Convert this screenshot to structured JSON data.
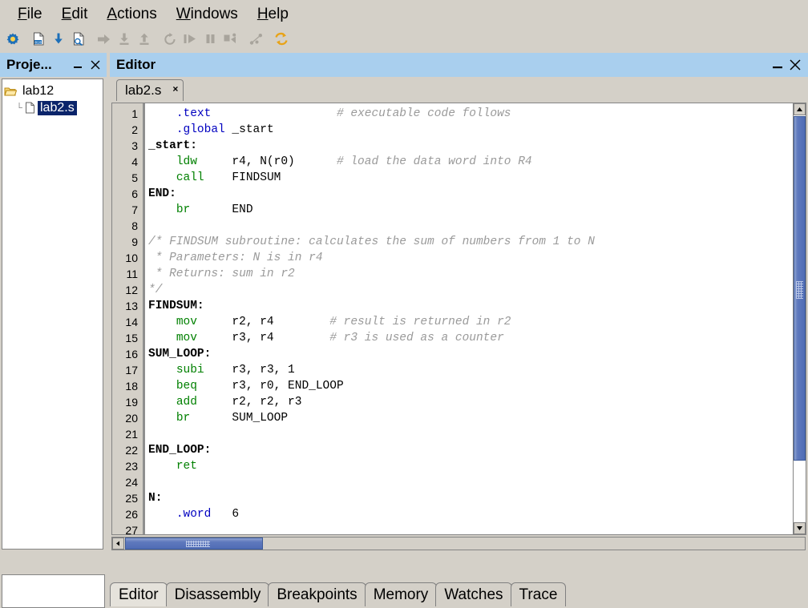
{
  "app": {
    "menu": [
      {
        "name": "menu-file",
        "mnemonic": "F",
        "rest": "ile"
      },
      {
        "name": "menu-edit",
        "mnemonic": "E",
        "rest": "dit"
      },
      {
        "name": "menu-actions",
        "mnemonic": "A",
        "rest": "ctions"
      },
      {
        "name": "menu-windows",
        "mnemonic": "W",
        "rest": "indows"
      },
      {
        "name": "menu-help",
        "mnemonic": "H",
        "rest": "elp"
      }
    ],
    "toolbar": [
      {
        "name": "settings-gear-icon",
        "label": "Settings",
        "enabled": true
      },
      {
        "name": "compile-icon",
        "label": "Compile",
        "enabled": true
      },
      {
        "name": "download-icon",
        "label": "Load",
        "enabled": true
      },
      {
        "name": "compile-and-load-icon",
        "label": "Compile and Load",
        "enabled": true
      },
      {
        "name": "continue-arrow-icon",
        "label": "Continue",
        "enabled": false
      },
      {
        "name": "step-into-icon",
        "label": "Step Into",
        "enabled": false
      },
      {
        "name": "step-out-icon",
        "label": "Step Out",
        "enabled": false
      },
      {
        "name": "restart-icon",
        "label": "Restart",
        "enabled": false
      },
      {
        "name": "run-icon",
        "label": "Run",
        "enabled": false
      },
      {
        "name": "pause-icon",
        "label": "Pause",
        "enabled": false
      },
      {
        "name": "step-over-icon",
        "label": "Step Over",
        "enabled": false
      },
      {
        "name": "connect-icon",
        "label": "Connect",
        "enabled": false
      },
      {
        "name": "refresh-icon",
        "label": "Refresh",
        "enabled": true
      }
    ]
  },
  "project_panel": {
    "title": "Proje...",
    "minimize_label": "—",
    "close_label": "✕",
    "tree": {
      "root": {
        "label": "lab12",
        "icon": "open-folder-icon"
      },
      "children": [
        {
          "label": "lab2.s",
          "icon": "file-icon",
          "selected": true
        }
      ]
    }
  },
  "editor_panel": {
    "title": "Editor",
    "minimize_label": "—",
    "close_label": "✕",
    "file_tab": {
      "label": "lab2.s",
      "close": "×"
    },
    "scroll": {
      "up_arrow": "▲",
      "down_arrow": "▼",
      "left_arrow": "◀",
      "right_arrow": "▶"
    }
  },
  "code": {
    "filename": "lab2.s",
    "total_visible_lines": 27,
    "lines": [
      {
        "n": 1,
        "tokens": [
          {
            "t": "    ",
            "c": "txt"
          },
          {
            "t": ".text",
            "c": "dir"
          },
          {
            "t": "                  ",
            "c": "txt"
          },
          {
            "t": "# executable code follows",
            "c": "com"
          }
        ]
      },
      {
        "n": 2,
        "tokens": [
          {
            "t": "    ",
            "c": "txt"
          },
          {
            "t": ".global",
            "c": "dir"
          },
          {
            "t": " _start",
            "c": "txt"
          }
        ]
      },
      {
        "n": 3,
        "tokens": [
          {
            "t": "_start:",
            "c": "lbl"
          }
        ]
      },
      {
        "n": 4,
        "tokens": [
          {
            "t": "    ",
            "c": "txt"
          },
          {
            "t": "ldw",
            "c": "ins"
          },
          {
            "t": "     r4, N(r0)      ",
            "c": "txt"
          },
          {
            "t": "# load the data word into R4",
            "c": "com"
          }
        ]
      },
      {
        "n": 5,
        "tokens": [
          {
            "t": "    ",
            "c": "txt"
          },
          {
            "t": "call",
            "c": "ins"
          },
          {
            "t": "    FINDSUM",
            "c": "txt"
          }
        ]
      },
      {
        "n": 6,
        "tokens": [
          {
            "t": "END:",
            "c": "lbl"
          }
        ]
      },
      {
        "n": 7,
        "tokens": [
          {
            "t": "    ",
            "c": "txt"
          },
          {
            "t": "br",
            "c": "ins"
          },
          {
            "t": "      END",
            "c": "txt"
          }
        ]
      },
      {
        "n": 8,
        "tokens": []
      },
      {
        "n": 9,
        "tokens": [
          {
            "t": "/* FINDSUM subroutine: calculates the sum of numbers from 1 to N",
            "c": "com"
          }
        ]
      },
      {
        "n": 10,
        "tokens": [
          {
            "t": " * Parameters: N is in r4",
            "c": "com"
          }
        ]
      },
      {
        "n": 11,
        "tokens": [
          {
            "t": " * Returns: sum in r2",
            "c": "com"
          }
        ]
      },
      {
        "n": 12,
        "tokens": [
          {
            "t": "*/",
            "c": "com"
          }
        ]
      },
      {
        "n": 13,
        "tokens": [
          {
            "t": "FINDSUM:",
            "c": "lbl"
          }
        ]
      },
      {
        "n": 14,
        "tokens": [
          {
            "t": "    ",
            "c": "txt"
          },
          {
            "t": "mov",
            "c": "ins"
          },
          {
            "t": "     r2, r4        ",
            "c": "txt"
          },
          {
            "t": "# result is returned in r2",
            "c": "com"
          }
        ]
      },
      {
        "n": 15,
        "tokens": [
          {
            "t": "    ",
            "c": "txt"
          },
          {
            "t": "mov",
            "c": "ins"
          },
          {
            "t": "     r3, r4        ",
            "c": "txt"
          },
          {
            "t": "# r3 is used as a counter",
            "c": "com"
          }
        ]
      },
      {
        "n": 16,
        "tokens": [
          {
            "t": "SUM_LOOP:",
            "c": "lbl"
          }
        ]
      },
      {
        "n": 17,
        "tokens": [
          {
            "t": "    ",
            "c": "txt"
          },
          {
            "t": "subi",
            "c": "ins"
          },
          {
            "t": "    r3, r3, 1",
            "c": "txt"
          }
        ]
      },
      {
        "n": 18,
        "tokens": [
          {
            "t": "    ",
            "c": "txt"
          },
          {
            "t": "beq",
            "c": "ins"
          },
          {
            "t": "     r3, r0, END_LOOP",
            "c": "txt"
          }
        ]
      },
      {
        "n": 19,
        "tokens": [
          {
            "t": "    ",
            "c": "txt"
          },
          {
            "t": "add",
            "c": "ins"
          },
          {
            "t": "     r2, r2, r3",
            "c": "txt"
          }
        ]
      },
      {
        "n": 20,
        "tokens": [
          {
            "t": "    ",
            "c": "txt"
          },
          {
            "t": "br",
            "c": "ins"
          },
          {
            "t": "      SUM_LOOP",
            "c": "txt"
          }
        ]
      },
      {
        "n": 21,
        "tokens": []
      },
      {
        "n": 22,
        "tokens": [
          {
            "t": "END_LOOP:",
            "c": "lbl"
          }
        ]
      },
      {
        "n": 23,
        "tokens": [
          {
            "t": "    ",
            "c": "txt"
          },
          {
            "t": "ret",
            "c": "ins"
          }
        ]
      },
      {
        "n": 24,
        "tokens": []
      },
      {
        "n": 25,
        "tokens": [
          {
            "t": "N:",
            "c": "lbl"
          }
        ]
      },
      {
        "n": 26,
        "tokens": [
          {
            "t": "    ",
            "c": "txt"
          },
          {
            "t": ".word",
            "c": "dir"
          },
          {
            "t": "   6",
            "c": "txt"
          }
        ]
      },
      {
        "n": 27,
        "tokens": []
      }
    ]
  },
  "bottom_tabs": [
    {
      "label": "Editor",
      "active": true
    },
    {
      "label": "Disassembly",
      "active": false
    },
    {
      "label": "Breakpoints",
      "active": false
    },
    {
      "label": "Memory",
      "active": false
    },
    {
      "label": "Watches",
      "active": false
    },
    {
      "label": "Trace",
      "active": false
    }
  ],
  "colors": {
    "panel_bg": "#d4d0c8",
    "title_bar": "#a9cfee",
    "selection": "#0a246a",
    "directive": "#0000c0",
    "instruction": "#008000",
    "comment": "#9a9a9a",
    "scrollbar_thumb": "#4f6cb5"
  }
}
